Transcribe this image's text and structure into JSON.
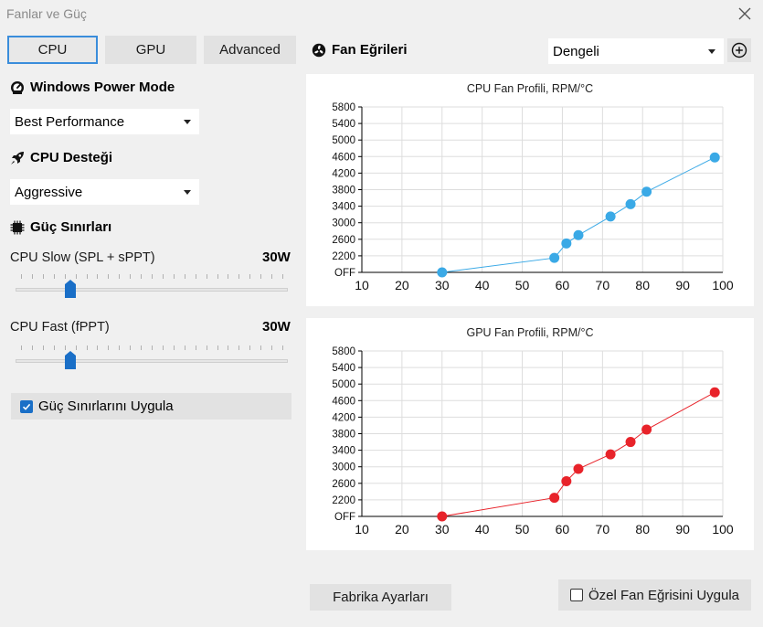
{
  "window": {
    "title": "Fanlar ve Güç"
  },
  "tabs": [
    {
      "label": "CPU",
      "active": true
    },
    {
      "label": "GPU",
      "active": false
    },
    {
      "label": "Advanced",
      "active": false
    }
  ],
  "power_mode": {
    "heading": "Windows Power Mode",
    "selected": "Best Performance"
  },
  "cpu_boost": {
    "heading": "CPU Desteği",
    "selected": "Aggressive"
  },
  "power_limits": {
    "heading": "Güç Sınırları",
    "slow": {
      "label": "CPU Slow (SPL + sPPT)",
      "value": "30W",
      "position": 0.19
    },
    "fast": {
      "label": "CPU Fast (fPPT)",
      "value": "30W",
      "position": 0.19
    },
    "apply": {
      "label": "Güç Sınırlarını Uygula",
      "checked": true
    }
  },
  "fan_curves": {
    "heading": "Fan Eğrileri",
    "preset": "Dengeli"
  },
  "chart_data": [
    {
      "type": "line",
      "title": "CPU Fan Profili, RPM/°C",
      "color": "#3aa9e6",
      "x": [
        30,
        58,
        61,
        64,
        72,
        77,
        81,
        98
      ],
      "y": [
        1800,
        2150,
        2500,
        2700,
        3150,
        3450,
        3750,
        4580
      ],
      "xlim": [
        10,
        100
      ],
      "ylim": [
        1800,
        5800
      ],
      "xticks": [
        "10",
        "20",
        "30",
        "40",
        "50",
        "60",
        "70",
        "80",
        "90",
        "100"
      ],
      "yticks": [
        "OFF",
        "2200",
        "2600",
        "3000",
        "3400",
        "3800",
        "4200",
        "4600",
        "5000",
        "5400",
        "5800"
      ],
      "grid": true
    },
    {
      "type": "line",
      "title": "GPU Fan Profili, RPM/°C",
      "color": "#e8232a",
      "x": [
        30,
        58,
        61,
        64,
        72,
        77,
        81,
        98
      ],
      "y": [
        1800,
        2250,
        2650,
        2950,
        3300,
        3600,
        3900,
        4800
      ],
      "xlim": [
        10,
        100
      ],
      "ylim": [
        1800,
        5800
      ],
      "xticks": [
        "10",
        "20",
        "30",
        "40",
        "50",
        "60",
        "70",
        "80",
        "90",
        "100"
      ],
      "yticks": [
        "OFF",
        "2200",
        "2600",
        "3000",
        "3400",
        "3800",
        "4200",
        "4600",
        "5000",
        "5400",
        "5800"
      ],
      "grid": true
    }
  ],
  "footer": {
    "factory_reset": "Fabrika Ayarları",
    "apply_custom_curve": {
      "label": "Özel Fan Eğrisini Uygula",
      "checked": false
    }
  }
}
